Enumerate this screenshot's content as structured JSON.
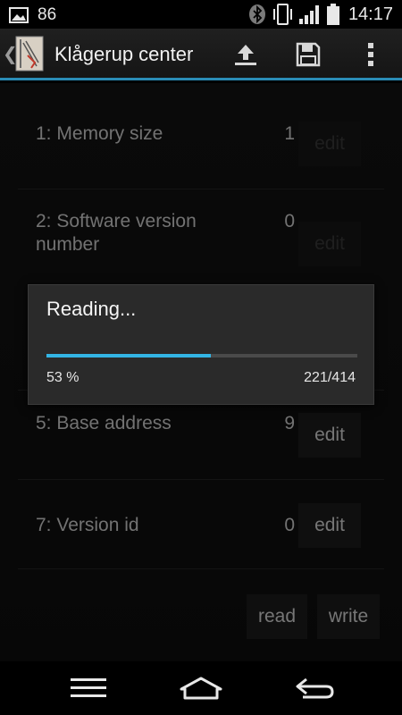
{
  "status_bar": {
    "notification_count": "86",
    "time": "14:17",
    "icons": [
      "gallery-icon",
      "bluetooth-icon",
      "vibrate-icon",
      "signal-icon",
      "battery-icon"
    ]
  },
  "action_bar": {
    "back_glyph": "❮",
    "title": "Klågerup center",
    "actions": [
      "upload-icon",
      "save-icon",
      "overflow-menu-icon"
    ]
  },
  "rows": [
    {
      "label": "1: Memory size",
      "value": "1",
      "button": "edit"
    },
    {
      "label": "2: Software version number",
      "value": "0",
      "button": "edit"
    },
    {
      "label": "5: Base address",
      "value": "9",
      "button": "edit"
    },
    {
      "label": "7: Version id",
      "value": "0",
      "button": "edit"
    }
  ],
  "footer": {
    "read_label": "read",
    "write_label": "write"
  },
  "dialog": {
    "title": "Reading...",
    "progress_fraction": 0.53,
    "percent_text": "53 %",
    "count_text": "221/414"
  },
  "nav": [
    "menu-icon",
    "home-icon",
    "back-icon"
  ],
  "colors": {
    "accent": "#33b5e5",
    "actionbar_divider": "#2a8cb6",
    "background": "#131313"
  }
}
